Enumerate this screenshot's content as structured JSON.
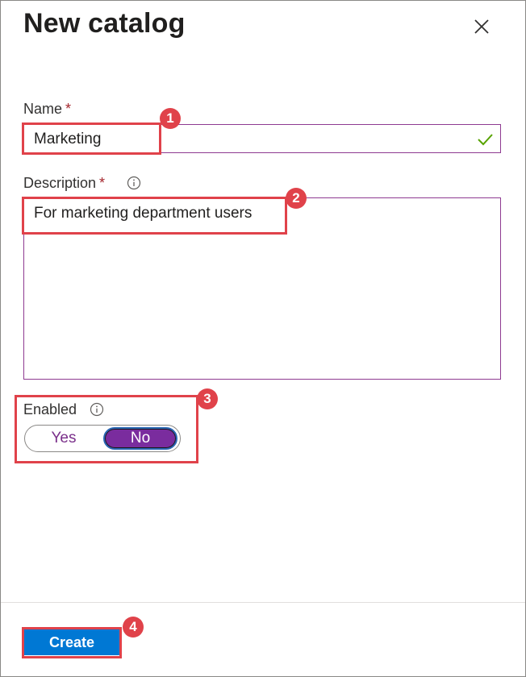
{
  "panel": {
    "title": "New catalog",
    "close_icon": "close-icon"
  },
  "name_field": {
    "label": "Name",
    "required_marker": "*",
    "value": "Marketing",
    "valid_icon": "checkmark-icon"
  },
  "description_field": {
    "label": "Description",
    "required_marker": "*",
    "info_icon": "info-icon",
    "value": "For marketing department users"
  },
  "enabled_field": {
    "label": "Enabled",
    "info_icon": "info-icon",
    "options": [
      "Yes",
      "No"
    ],
    "selected": "No"
  },
  "footer": {
    "create_label": "Create"
  },
  "callouts": {
    "badge_1": "1",
    "badge_2": "2",
    "badge_3": "3",
    "badge_4": "4"
  },
  "colors": {
    "accent_purple": "#7a2c9e",
    "primary_blue": "#0078d4",
    "callout_red": "#e0424a",
    "required_red": "#a4262c",
    "valid_green": "#57a300"
  }
}
